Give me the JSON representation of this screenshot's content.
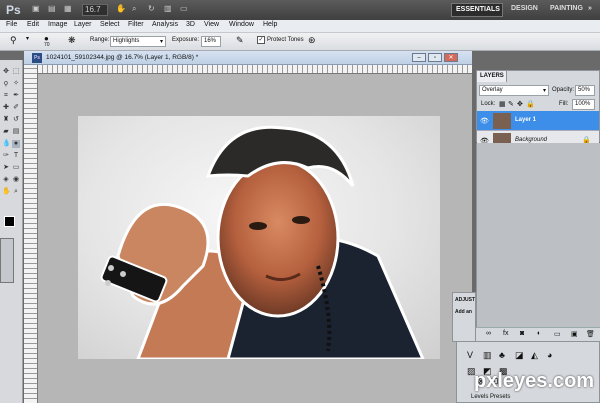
{
  "app": {
    "logo": "Ps",
    "zoom": "16.7",
    "workspaces": {
      "essentials": "ESSENTIALS",
      "design": "DESIGN",
      "painting": "PAINTING",
      "more": "»"
    }
  },
  "menu": [
    "File",
    "Edit",
    "Image",
    "Layer",
    "Select",
    "Filter",
    "Analysis",
    "3D",
    "View",
    "Window",
    "Help"
  ],
  "options": {
    "brush_size": "70",
    "range_label": "Range:",
    "range_value": "Highlights",
    "exposure_label": "Exposure:",
    "exposure_value": "16%",
    "protect_tones": "Protect Tones"
  },
  "document": {
    "title": "1024101_59102344.jpg @ 16.7% (Layer 1, RGB/8) *"
  },
  "layers_panel": {
    "tab": "LAYERS",
    "blend_mode": "Overlay",
    "opacity_label": "Opacity:",
    "opacity_value": "50%",
    "lock_label": "Lock:",
    "fill_label": "Fill:",
    "fill_value": "100%",
    "layers": [
      {
        "name": "Layer 1",
        "selected": true
      },
      {
        "name": "Background",
        "selected": false
      }
    ]
  },
  "adjustments": {
    "tab": "ADJUST",
    "add_label": "Add an",
    "preset_label": "Levels Presets"
  },
  "watermark": "pxleyes.com",
  "colors": {
    "selected_layer": "#3d8ee8",
    "app_bar": "#4a4a4a",
    "menu_bar": "#e9ecf1"
  }
}
